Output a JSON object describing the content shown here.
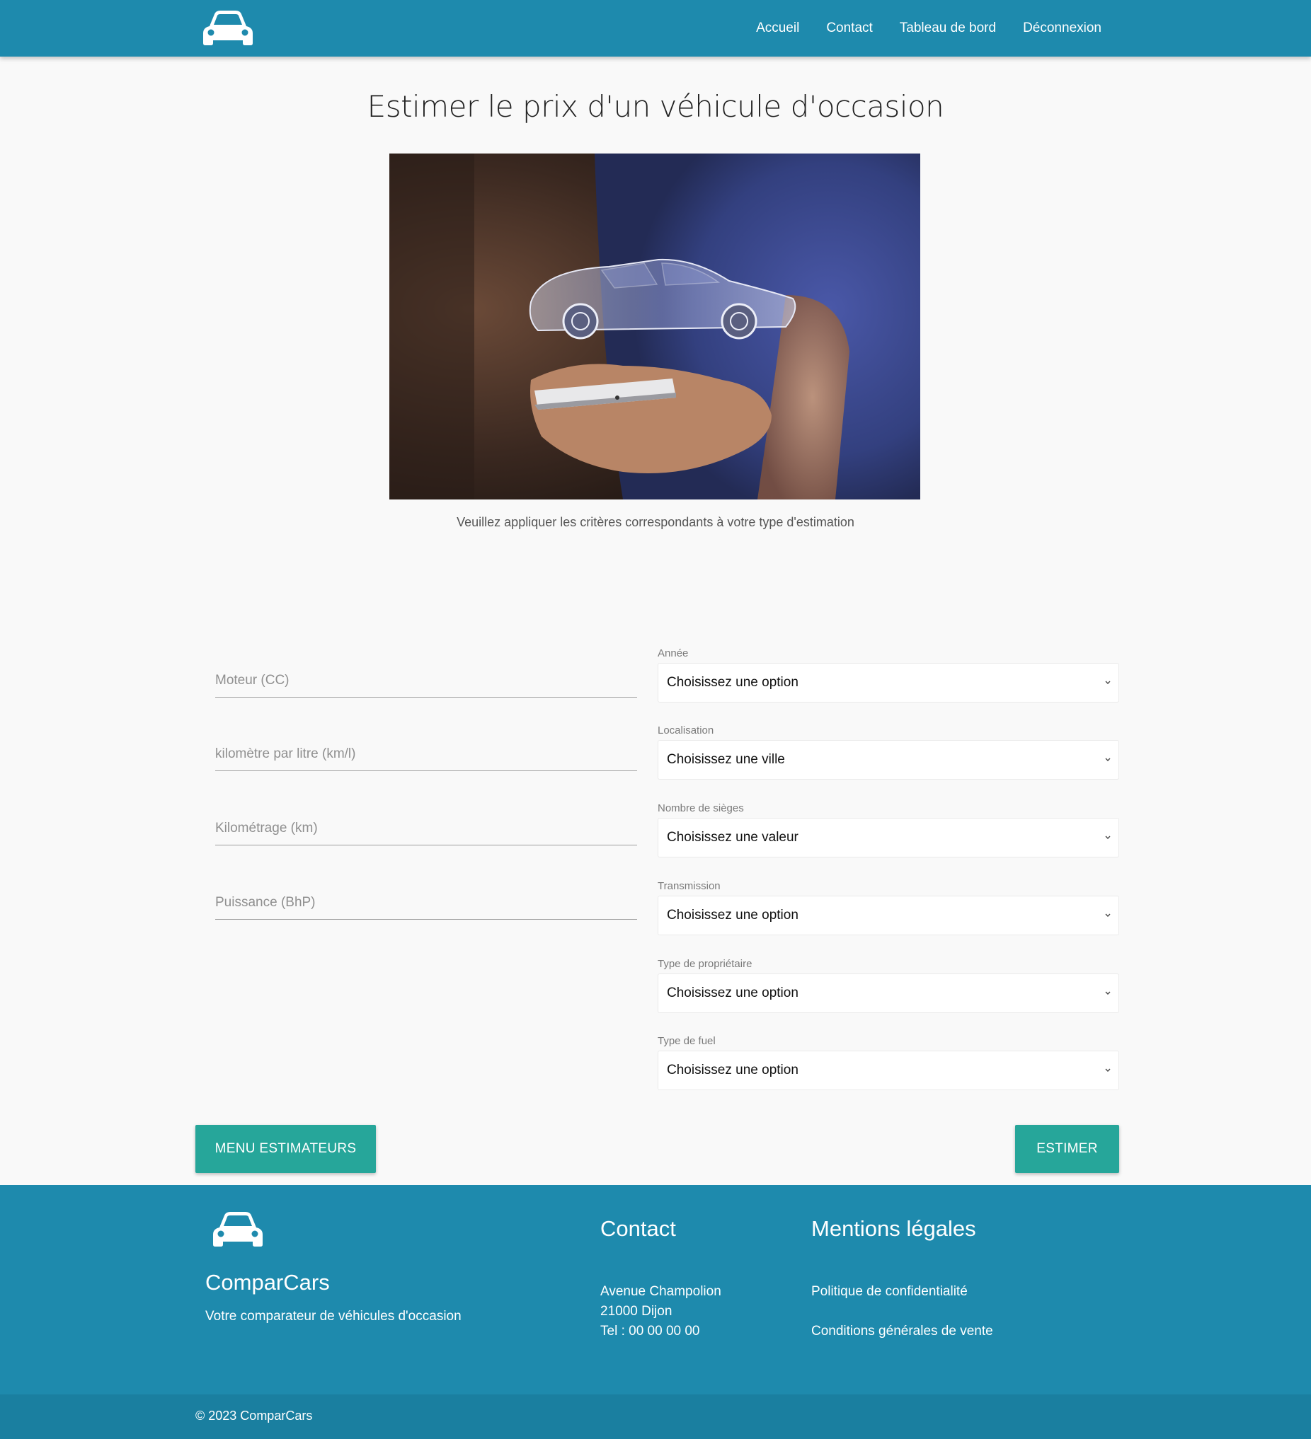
{
  "nav": {
    "links": [
      "Accueil",
      "Contact",
      "Tableau de bord",
      "Déconnexion"
    ]
  },
  "page": {
    "title": "Estimer le prix d'un véhicule d'occasion",
    "caption": "Veuillez appliquer les critères correspondants à votre type d'estimation"
  },
  "form": {
    "inputs": [
      {
        "placeholder": "Moteur (CC)"
      },
      {
        "placeholder": "kilomètre par litre (km/l)"
      },
      {
        "placeholder": "Kilométrage (km)"
      },
      {
        "placeholder": "Puissance (BhP)"
      }
    ],
    "selects": [
      {
        "label": "Année",
        "value": "Choisissez une option"
      },
      {
        "label": "Localisation",
        "value": "Choisissez une ville"
      },
      {
        "label": "Nombre de sièges",
        "value": "Choisissez une valeur"
      },
      {
        "label": "Transmission",
        "value": "Choisissez une option"
      },
      {
        "label": "Type de propriétaire",
        "value": "Choisissez une option"
      },
      {
        "label": "Type de fuel",
        "value": "Choisissez une option"
      }
    ],
    "menu_button": "MENU ESTIMATEURS",
    "submit_button": "ESTIMER"
  },
  "footer": {
    "brand": "ComparCars",
    "tagline": "Votre comparateur de véhicules d'occasion",
    "contact_heading": "Contact",
    "address_line1": "Avenue Champolion",
    "address_line2": "21000 Dijon",
    "phone": "Tel : 00 00 00 00",
    "legal_heading": "Mentions légales",
    "privacy": "Politique de confidentialité",
    "terms": "Conditions générales de vente",
    "copyright": "© 2023 ComparCars"
  },
  "colors": {
    "primary": "#1e8aad",
    "accent": "#26a69a",
    "background": "#f9f9f9"
  },
  "icons": {
    "logo": "car-icon",
    "select_chevron": "chevron-down-icon"
  }
}
